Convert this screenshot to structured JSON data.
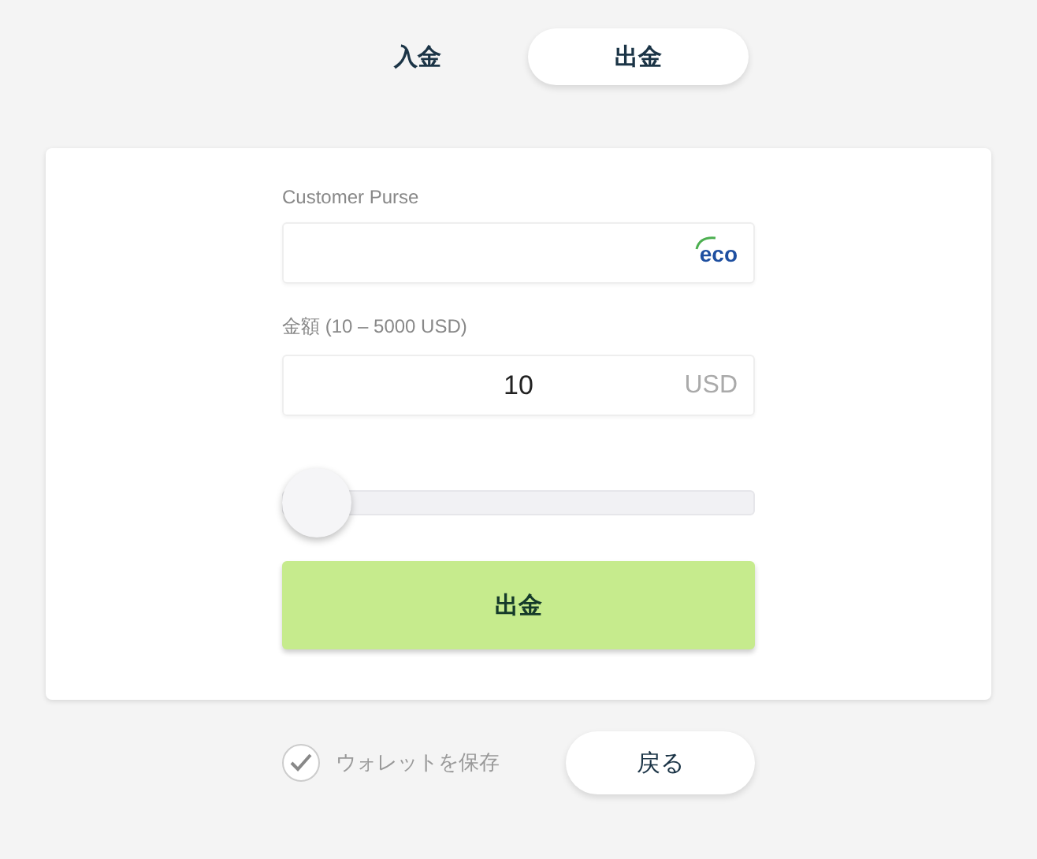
{
  "tabs": [
    {
      "label": "入金",
      "selected": false
    },
    {
      "label": "出金",
      "selected": true
    }
  ],
  "form": {
    "purse_label": "Customer Purse",
    "purse_logo": "eco",
    "amount_label": "金額 (10 – 5000 USD)",
    "amount_value": "10",
    "currency": "USD",
    "slider": {
      "level": 0
    },
    "submit": "出金"
  },
  "save_wallet": {
    "label": "ウォレットを保存",
    "checked": true
  },
  "back_button": "戻る"
}
